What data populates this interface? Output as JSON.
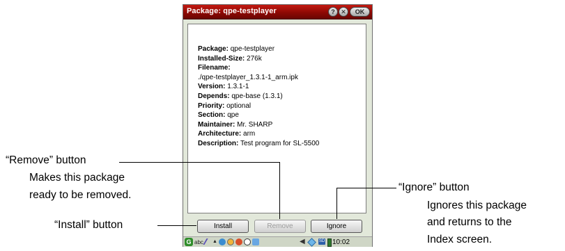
{
  "window": {
    "title": "Package: qpe-testplayer",
    "help_glyph": "?",
    "close_glyph": "✕",
    "ok_label": "OK"
  },
  "package_info": [
    {
      "key": "Package:",
      "value": " qpe-testplayer"
    },
    {
      "key": "Installed-Size:",
      "value": " 276k"
    },
    {
      "key": "Filename:",
      "value": ""
    },
    {
      "key": "",
      "value": "./qpe-testplayer_1.3.1-1_arm.ipk"
    },
    {
      "key": "Version:",
      "value": " 1.3.1-1"
    },
    {
      "key": "Depends:",
      "value": " qpe-base (1.3.1)"
    },
    {
      "key": "Priority:",
      "value": " optional"
    },
    {
      "key": "Section:",
      "value": " qpe"
    },
    {
      "key": "Maintainer:",
      "value": " Mr. SHARP"
    },
    {
      "key": "Architecture:",
      "value": " arm"
    },
    {
      "key": "Description:",
      "value": " Test program for SL-5500"
    }
  ],
  "buttons": {
    "install": "Install",
    "remove": "Remove",
    "ignore": "Ignore"
  },
  "taskbar": {
    "start_glyph": "G",
    "input_method": "abc",
    "clock": "10:02",
    "icons": [
      "start-icon",
      "pen-icon",
      "up-arrow-icon",
      "app-icon",
      "app-icon",
      "app-icon",
      "clock-icon",
      "app-icon",
      "speaker-icon",
      "network-icon",
      "sd-card-icon",
      "battery-icon"
    ]
  },
  "callouts": {
    "remove_title": "“Remove” button",
    "remove_desc_1": "Makes this package",
    "remove_desc_2": "ready to be removed.",
    "install_title": "“Install” button",
    "ignore_title": "“Ignore” button",
    "ignore_desc_1": "Ignores this package",
    "ignore_desc_2": "and returns to the",
    "ignore_desc_3": "Index screen."
  },
  "colors": {
    "titlebar": "#8e0904",
    "window_bg": "#e2e8da",
    "disabled_text": "#9c9c9c"
  }
}
